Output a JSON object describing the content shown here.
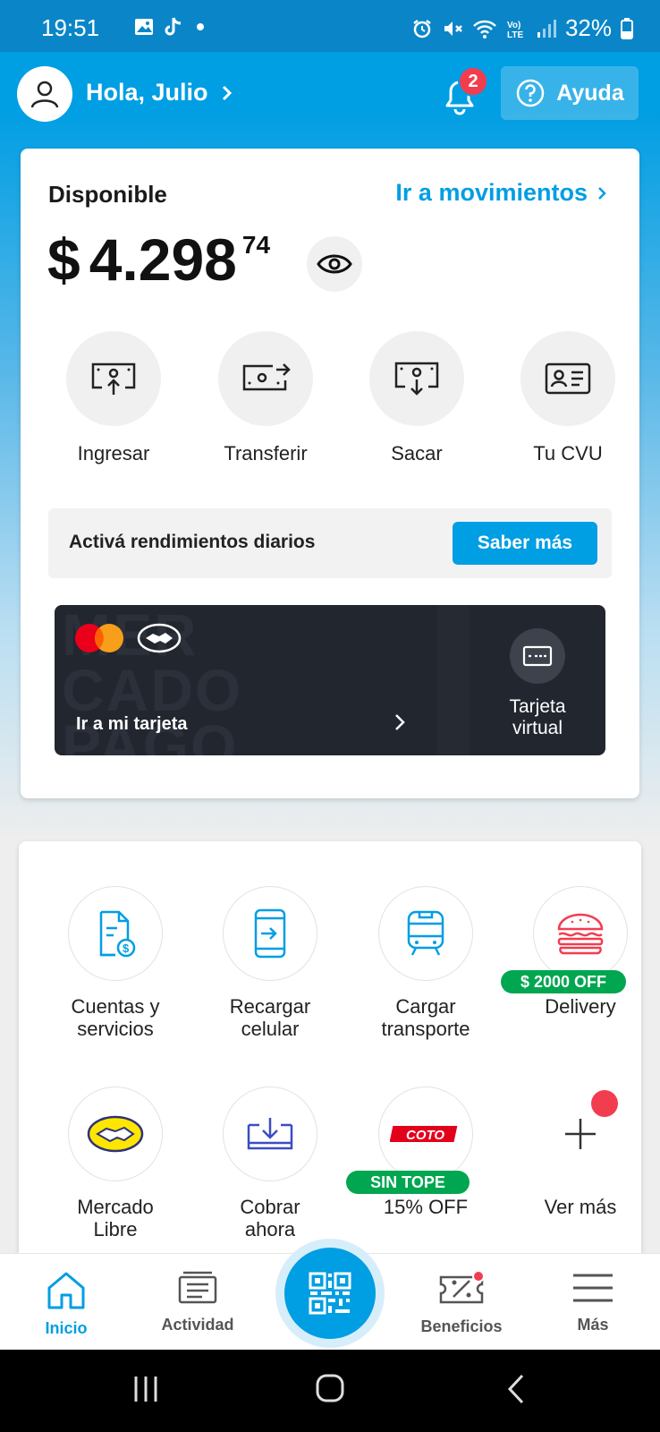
{
  "status": {
    "time": "19:51",
    "battery": "32%"
  },
  "header": {
    "greeting": "Hola, Julio",
    "notification_count": "2",
    "help_label": "Ayuda"
  },
  "balance": {
    "label": "Disponible",
    "movements_link": "Ir a movimientos",
    "currency": "$",
    "amount": "4.298",
    "cents": "74"
  },
  "actions": [
    {
      "label": "Ingresar",
      "icon": "deposit-icon"
    },
    {
      "label": "Transferir",
      "icon": "transfer-icon"
    },
    {
      "label": "Sacar",
      "icon": "withdraw-icon"
    },
    {
      "label": "Tu CVU",
      "icon": "id-card-icon"
    }
  ],
  "promo": {
    "text": "Activá rendimientos diarios",
    "button": "Saber más"
  },
  "card": {
    "watermark": "MER\nCADO\nPAGO",
    "link": "Ir a mi tarjeta",
    "virtual_label": "Tarjeta virtual"
  },
  "services": [
    {
      "label": "Cuentas y servicios",
      "icon": "bill-icon"
    },
    {
      "label": "Recargar celular",
      "icon": "phone-recharge-icon"
    },
    {
      "label": "Cargar transporte",
      "icon": "bus-icon"
    },
    {
      "label": "Delivery",
      "icon": "burger-icon",
      "tag": "$ 2000 OFF"
    },
    {
      "label": "Mercado Libre",
      "icon": "mercadolibre-icon"
    },
    {
      "label": "Cobrar ahora",
      "icon": "collect-icon"
    },
    {
      "label": "15% OFF",
      "icon": "coto-icon",
      "tag": "SIN TOPE",
      "logo_text": "COTO"
    },
    {
      "label": "Ver más",
      "icon": "plus-icon"
    }
  ],
  "nav": [
    {
      "label": "Inicio",
      "icon": "home-icon",
      "active": true
    },
    {
      "label": "Actividad",
      "icon": "activity-icon"
    },
    {
      "label": "Beneficios",
      "icon": "ticket-icon"
    },
    {
      "label": "Más",
      "icon": "menu-icon"
    }
  ],
  "colors": {
    "brand_blue": "#009ee3",
    "promo_green": "#00a650",
    "badge_red": "#f23d4f",
    "card_dark": "#22262f"
  }
}
